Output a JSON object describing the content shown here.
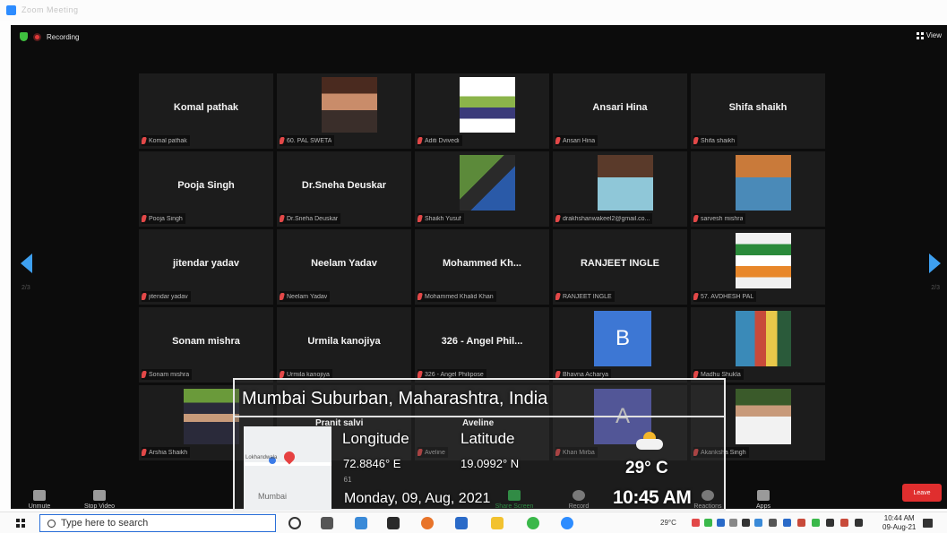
{
  "window": {
    "title": "Zoom Meeting"
  },
  "meeting": {
    "recording_label": "Recording",
    "view_label": "View",
    "page_left": "2/3",
    "page_right": "2/3"
  },
  "tiles": [
    {
      "name": "Komal pathak",
      "label": "Komal pathak"
    },
    {
      "name": "",
      "label": "60. PAL SWETA"
    },
    {
      "name": "",
      "label": "Aditi Dvivedi"
    },
    {
      "name": "Ansari Hina",
      "label": "Ansari Hina"
    },
    {
      "name": "Shifa shaikh",
      "label": "Shifa shaikh"
    },
    {
      "name": "Pooja Singh",
      "label": "Pooja Singh"
    },
    {
      "name": "Dr.Sneha Deuskar",
      "label": "Dr.Sneha Deuskar"
    },
    {
      "name": "",
      "label": "Shaikh Yusuf"
    },
    {
      "name": "",
      "label": "drakhshanwakeel2@gmail.co..."
    },
    {
      "name": "",
      "label": "sarvesh mishra"
    },
    {
      "name": "jitendar yadav",
      "label": "jitendar yadav"
    },
    {
      "name": "Neelam Yadav",
      "label": "Neelam Yadav"
    },
    {
      "name": "Mohammed  Kh...",
      "label": "Mohammed Khalid Khan"
    },
    {
      "name": "RANJEET INGLE",
      "label": "RANJEET INGLE"
    },
    {
      "name": "",
      "label": "57. AVDHESH PAL"
    },
    {
      "name": "Sonam mishra",
      "label": "Sonam mishra"
    },
    {
      "name": "Urmila kanojiya",
      "label": "Urmila kanojiya"
    },
    {
      "name": "326 - Angel Phil...",
      "label": "326 - Angel Philipose"
    },
    {
      "name": "",
      "label": "Bhavna Acharya",
      "avatar": "B"
    },
    {
      "name": "",
      "label": "Madhu Shukla"
    },
    {
      "name": "",
      "label": "Arshia Shaikh"
    },
    {
      "name": "Pranit salvi",
      "label": ""
    },
    {
      "name": "Aveline",
      "label": "Aveline"
    },
    {
      "name": "",
      "label": "Khan Mirba",
      "avatar": "A"
    },
    {
      "name": "",
      "label": "Akanksha Singh"
    }
  ],
  "overlay": {
    "location": "Mumbai Suburban, Maharashtra, India",
    "longitude_label": "Longitude",
    "latitude_label": "Latitude",
    "longitude": "72.8846° E",
    "latitude": "19.0992° N",
    "date": "Monday, 09, Aug, 2021",
    "temperature": "29° C",
    "time": "10:45 AM",
    "map_label": "Mumbai",
    "map_small": "Lokhandwala"
  },
  "toolbar": {
    "unmute": "Unmute",
    "stop_video": "Stop Video",
    "participants_count": "61",
    "share_screen": "Share Screen",
    "record": "Record",
    "reactions": "Reactions",
    "apps": "Apps",
    "leave": "Leave"
  },
  "taskbar": {
    "search_placeholder": "Type here to search",
    "temp": "29°C",
    "time": "10:44 AM",
    "date": "09-Aug-21"
  },
  "colors": {
    "accent": "#3ea0f0",
    "leave": "#e02e2e",
    "avatar": "#3d77d4",
    "mic_muted": "#e24848"
  }
}
